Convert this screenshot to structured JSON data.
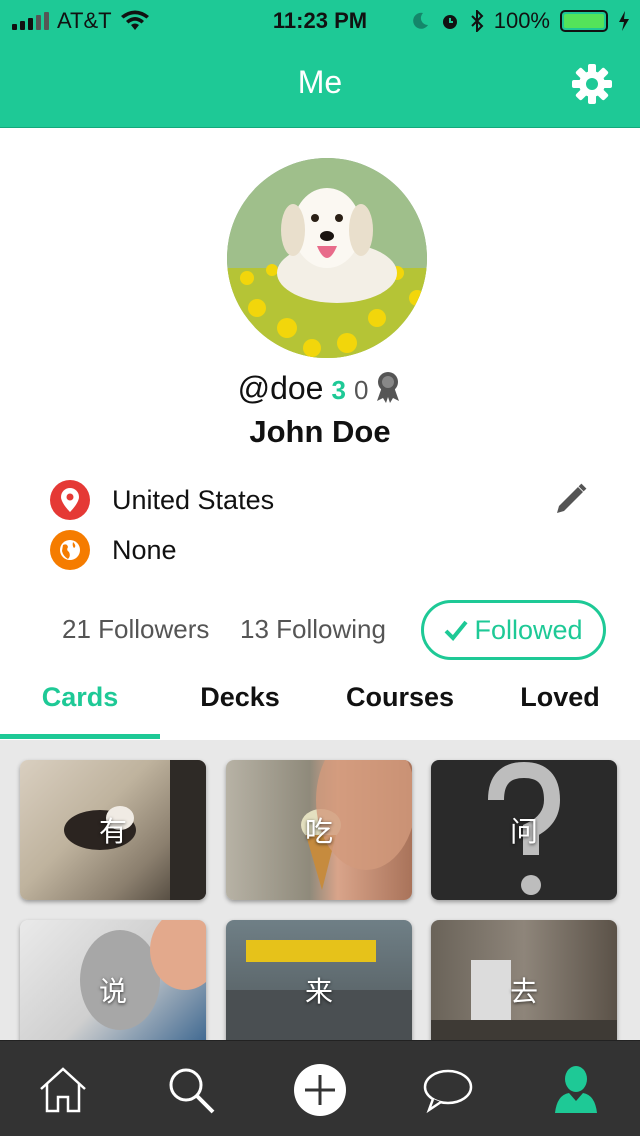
{
  "status_bar": {
    "carrier": "AT&T",
    "time": "11:23 PM",
    "battery": "100%"
  },
  "header": {
    "title": "Me",
    "settings_icon": "gear-icon"
  },
  "profile": {
    "handle": "@doe",
    "count_primary": "3",
    "count_secondary": "0",
    "award_icon": "ribbon-icon",
    "full_name": "John Doe",
    "country": "United States",
    "language": "None",
    "country_icon": "location-pin-icon",
    "language_icon": "globe-icon"
  },
  "follow": {
    "followers": "21 Followers",
    "following": "13 Following",
    "followed_label": "Followed"
  },
  "tabs": [
    {
      "label": "Cards",
      "active": true
    },
    {
      "label": "Decks",
      "active": false
    },
    {
      "label": "Courses",
      "active": false
    },
    {
      "label": "Loved",
      "active": false
    }
  ],
  "cards": [
    {
      "label": "有"
    },
    {
      "label": "吃"
    },
    {
      "label": "问"
    },
    {
      "label": "说"
    },
    {
      "label": "来"
    },
    {
      "label": "去"
    }
  ],
  "colors": {
    "accent": "#1ec996",
    "nav_bg": "#333333",
    "pin_red": "#e53935",
    "globe_orange": "#f57c00"
  },
  "bottom_nav": [
    {
      "icon": "home-icon",
      "active": false
    },
    {
      "icon": "search-icon",
      "active": false
    },
    {
      "icon": "add-icon",
      "active": false
    },
    {
      "icon": "chat-icon",
      "active": false
    },
    {
      "icon": "profile-icon",
      "active": true
    }
  ]
}
